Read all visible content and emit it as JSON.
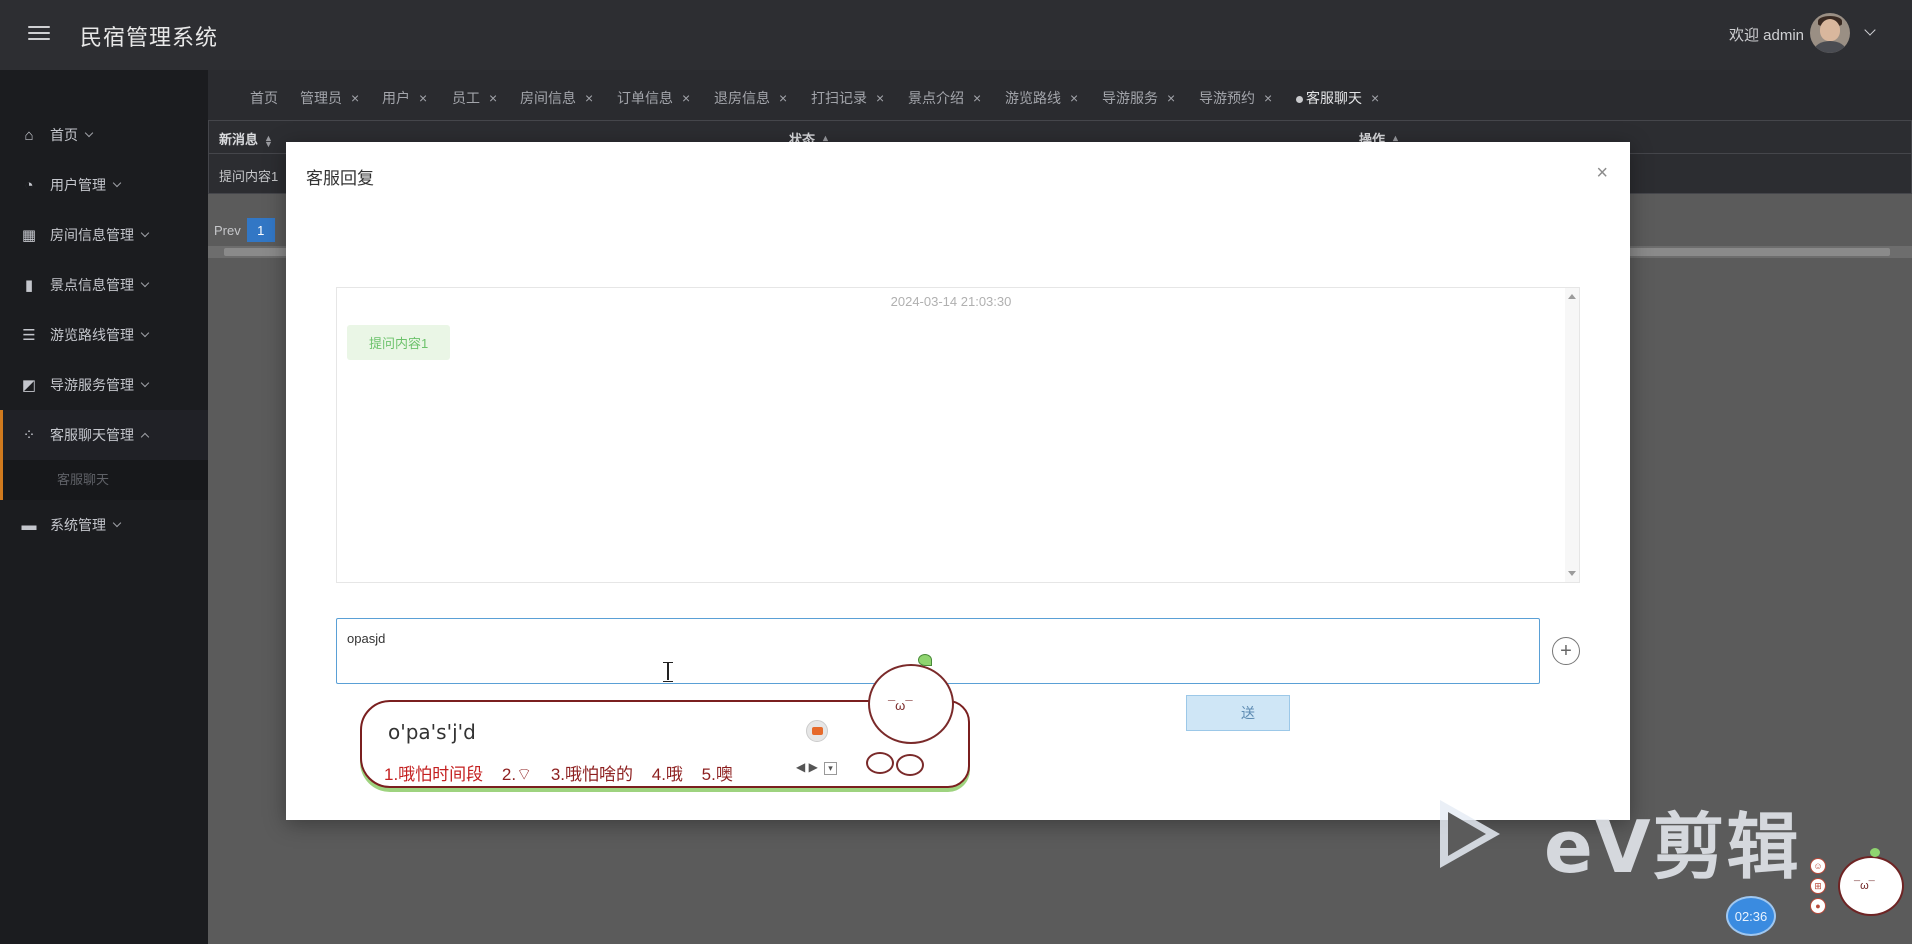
{
  "header": {
    "title": "民宿管理系统",
    "welcome": "欢迎 admin"
  },
  "sidebar": {
    "items": [
      {
        "label": "首页",
        "icon": "home-icon"
      },
      {
        "label": "用户管理",
        "icon": "dashboard-icon"
      },
      {
        "label": "房间信息管理",
        "icon": "store-icon"
      },
      {
        "label": "景点信息管理",
        "icon": "bookmark-icon"
      },
      {
        "label": "游览路线管理",
        "icon": "server-icon"
      },
      {
        "label": "导游服务管理",
        "icon": "chart-icon"
      },
      {
        "label": "客服聊天管理",
        "icon": "grid-icon"
      },
      {
        "label": "系统管理",
        "icon": "card-icon"
      }
    ],
    "sub_item": "客服聊天"
  },
  "tabs": [
    {
      "label": "首页"
    },
    {
      "label": "管理员"
    },
    {
      "label": "用户"
    },
    {
      "label": "员工"
    },
    {
      "label": "房间信息"
    },
    {
      "label": "订单信息"
    },
    {
      "label": "退房信息"
    },
    {
      "label": "打扫记录"
    },
    {
      "label": "景点介绍"
    },
    {
      "label": "游览路线"
    },
    {
      "label": "导游服务"
    },
    {
      "label": "导游预约"
    },
    {
      "label": "客服聊天"
    }
  ],
  "table": {
    "columns": [
      "新消息",
      "状态",
      "操作"
    ],
    "row": "提问内容1"
  },
  "pager": {
    "prev": "Prev",
    "current": "1"
  },
  "modal": {
    "title": "客服回复",
    "close": "×",
    "chat_time": "2024-03-14 21:03:30",
    "message": "提问内容1",
    "input_value": "opasjd",
    "send_label": "送"
  },
  "ime": {
    "composition": "o'pa's'j'd",
    "candidates": [
      "1.哦怕时间段",
      "2.⌔",
      "3.哦怕啥的",
      "4.哦",
      "5.噢"
    ]
  },
  "watermark": "eV剪辑",
  "timer": "02:36",
  "colors": {
    "header_bg": "#2d2e32",
    "sidebar_bg": "#1b1c1f",
    "accent": "#d07a1e",
    "pager_active": "#3277c5",
    "chat_bubble": "#eaf6e6",
    "input_border": "#5aa0d6"
  }
}
